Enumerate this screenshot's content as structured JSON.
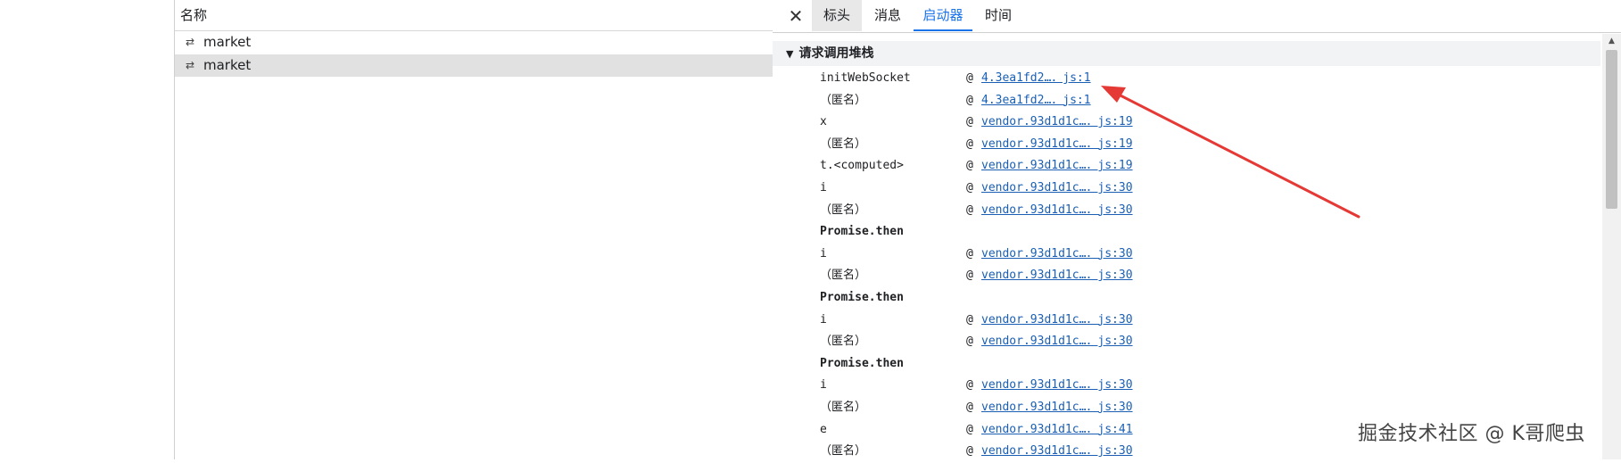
{
  "list": {
    "header": "名称",
    "requests": [
      {
        "name": "market",
        "selected": false
      },
      {
        "name": "market",
        "selected": true
      }
    ]
  },
  "detail": {
    "tabs": [
      "标头",
      "消息",
      "启动器",
      "时间"
    ],
    "active_tab": "启动器",
    "section_title": "请求调用堆栈",
    "frames": [
      {
        "fn": "initWebSocket",
        "at": "@",
        "src": "4.3ea1fd2…．js:1"
      },
      {
        "fn": "（匿名）",
        "at": "@",
        "src": "4.3ea1fd2…．js:1"
      },
      {
        "fn": "x",
        "at": "@",
        "src": "vendor.93d1d1c…．js:19"
      },
      {
        "fn": "（匿名）",
        "at": "@",
        "src": "vendor.93d1d1c…．js:19"
      },
      {
        "fn": "t.<computed>",
        "at": "@",
        "src": "vendor.93d1d1c…．js:19"
      },
      {
        "fn": "i",
        "at": "@",
        "src": "vendor.93d1d1c…．js:30"
      },
      {
        "fn": "（匿名）",
        "at": "@",
        "src": "vendor.93d1d1c…．js:30"
      },
      {
        "async": "Promise.then"
      },
      {
        "fn": "i",
        "at": "@",
        "src": "vendor.93d1d1c…．js:30"
      },
      {
        "fn": "（匿名）",
        "at": "@",
        "src": "vendor.93d1d1c…．js:30"
      },
      {
        "async": "Promise.then"
      },
      {
        "fn": "i",
        "at": "@",
        "src": "vendor.93d1d1c…．js:30"
      },
      {
        "fn": "（匿名）",
        "at": "@",
        "src": "vendor.93d1d1c…．js:30"
      },
      {
        "async": "Promise.then"
      },
      {
        "fn": "i",
        "at": "@",
        "src": "vendor.93d1d1c…．js:30"
      },
      {
        "fn": "（匿名）",
        "at": "@",
        "src": "vendor.93d1d1c…．js:30"
      },
      {
        "fn": "e",
        "at": "@",
        "src": "vendor.93d1d1c…．js:41"
      },
      {
        "fn": "（匿名）",
        "at": "@",
        "src": "vendor.93d1d1c…．js:30"
      }
    ]
  },
  "icons": {
    "request": "websocket-arrows-icon",
    "close": "close-icon",
    "section_toggle": "triangle-down-icon"
  },
  "colors": {
    "link": "#1a5fb4",
    "active_tab": "#1a73e8",
    "selected_row": "#e1e1e1",
    "annotation_arrow": "#e53935"
  },
  "watermark": "掘金技术社区 @ K哥爬虫"
}
